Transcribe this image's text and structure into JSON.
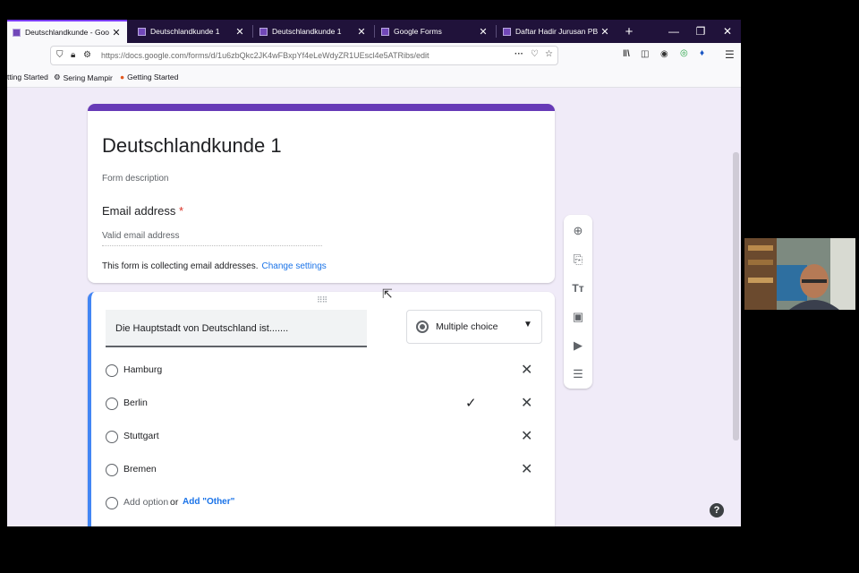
{
  "tabs": [
    {
      "title": "Deutschlandkunde - Goo"
    },
    {
      "title": "Deutschlandkunde 1"
    },
    {
      "title": "Deutschlandkunde 1"
    },
    {
      "title": "Google Forms"
    },
    {
      "title": "Daftar Hadir Jurusan PB Je"
    }
  ],
  "new_tab_label": "+",
  "url": "https://docs.google.com/forms/d/1u6zbQkc2JK4wFBxpYf4eLeWdyZR1UEscl4e5ATRibs/edit",
  "bookmarks": [
    "tting Started",
    "Sering Mampir",
    "Getting Started"
  ],
  "form": {
    "title": "Deutschlandkunde 1",
    "description_placeholder": "Form description",
    "email_label": "Email address",
    "required_mark": "*",
    "email_placeholder": "Valid email address",
    "collecting_note": "This form is collecting email addresses.",
    "change_settings_link": "Change settings"
  },
  "question": {
    "text": "Die Hauptstadt von Deutschland ist.......",
    "type": "Multiple choice",
    "options": [
      {
        "label": "Hamburg",
        "correct": false
      },
      {
        "label": "Berlin",
        "correct": true
      },
      {
        "label": "Stuttgart",
        "correct": false
      },
      {
        "label": "Bremen",
        "correct": false
      }
    ],
    "add_option_label": "Add option",
    "or_label": "or",
    "add_other_label": "Add \"Other\""
  },
  "toolbar_icons": [
    "add-question-icon",
    "import-questions-icon",
    "add-title-icon",
    "add-image-icon",
    "add-video-icon",
    "add-section-icon"
  ],
  "colors": {
    "theme": "#673ab7",
    "accent": "#4285f4",
    "link": "#1a73e8",
    "tabstrip": "#20123a"
  }
}
